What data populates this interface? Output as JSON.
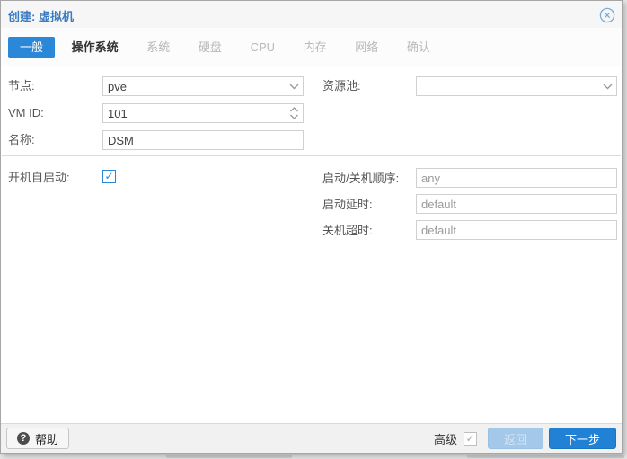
{
  "window": {
    "title": "创建: 虚拟机"
  },
  "tabs": [
    {
      "label": "一般",
      "state": "active"
    },
    {
      "label": "操作系统",
      "state": "enabled"
    },
    {
      "label": "系统",
      "state": "disabled"
    },
    {
      "label": "硬盘",
      "state": "disabled"
    },
    {
      "label": "CPU",
      "state": "disabled"
    },
    {
      "label": "内存",
      "state": "disabled"
    },
    {
      "label": "网络",
      "state": "disabled"
    },
    {
      "label": "确认",
      "state": "disabled"
    }
  ],
  "form": {
    "node": {
      "label": "节点:",
      "value": "pve"
    },
    "pool": {
      "label": "资源池:",
      "value": ""
    },
    "vmid": {
      "label": "VM ID:",
      "value": "101"
    },
    "vm_name": {
      "label": "名称:",
      "value": "DSM"
    },
    "autostart": {
      "label": "开机自启动:",
      "checked": true
    },
    "startup_order": {
      "label": "启动/关机顺序:",
      "placeholder": "any",
      "value": ""
    },
    "startup_delay": {
      "label": "启动延时:",
      "placeholder": "default",
      "value": ""
    },
    "shutdown_timeout": {
      "label": "关机超时:",
      "placeholder": "default",
      "value": ""
    }
  },
  "footer": {
    "help_label": "帮助",
    "advanced_label": "高级",
    "advanced_checked": true,
    "back_label": "返回",
    "next_label": "下一步"
  },
  "icons": {
    "check": "✓",
    "question": "?"
  },
  "colors": {
    "accent": "#2b87d8",
    "title_blue": "#3a7cc1",
    "disabled_btn": "#a3c8e9"
  }
}
